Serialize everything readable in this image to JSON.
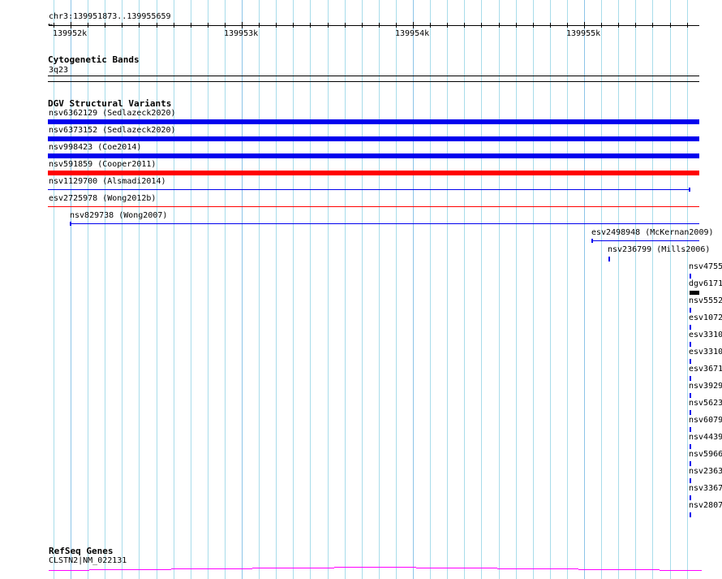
{
  "ruler": {
    "region": "chr3:139951873..139955659",
    "tick_labels": [
      "139952k",
      "139953k",
      "139954k",
      "139955k"
    ]
  },
  "cytoband_track": {
    "title": "Cytogenetic Bands",
    "band": "3q23"
  },
  "dgv_track": {
    "title": "DGV Structural Variants",
    "colors": {
      "gain": "#0000ee",
      "loss": "#ff0000",
      "other": "#000000"
    },
    "features": [
      {
        "label": "nsv6362129 (Sedlazeck2020)",
        "color": "#0000ee",
        "style": "thick"
      },
      {
        "label": "nsv6373152 (Sedlazeck2020)",
        "color": "#0000ee",
        "style": "thick"
      },
      {
        "label": "nsv998423 (Coe2014)",
        "color": "#0000ee",
        "style": "thick"
      },
      {
        "label": "nsv591859 (Cooper2011)",
        "color": "#ff0000",
        "style": "thick"
      },
      {
        "label": "nsv1129700 (Alsmadi2014)",
        "color": "#0000ee",
        "style": "thin"
      },
      {
        "label": "esv2725978 (Wong2012b)",
        "color": "#ff0000",
        "style": "thin"
      },
      {
        "label": "nsv829738 (Wong2007)",
        "color": "#0000ee",
        "style": "thin"
      },
      {
        "label": "esv2498948 (McKernan2009)",
        "color": "#0000ee",
        "style": "thin"
      },
      {
        "label": "nsv236799 (Mills2006)",
        "color": "#0000ee",
        "style": "small"
      },
      {
        "label": "nsv4755",
        "color": "#0000ee",
        "style": "small"
      },
      {
        "label": "dgv6171",
        "color": "#000000",
        "style": "box"
      },
      {
        "label": "nsv5552",
        "color": "#0000ee",
        "style": "small"
      },
      {
        "label": "esv1072",
        "color": "#0000ee",
        "style": "small"
      },
      {
        "label": "esv3310",
        "color": "#0000ee",
        "style": "small"
      },
      {
        "label": "esv3310",
        "color": "#0000ee",
        "style": "small"
      },
      {
        "label": "esv3671",
        "color": "#0000ee",
        "style": "small"
      },
      {
        "label": "nsv3929",
        "color": "#0000ee",
        "style": "small"
      },
      {
        "label": "nsv5623",
        "color": "#0000ee",
        "style": "small"
      },
      {
        "label": "nsv6079",
        "color": "#0000ee",
        "style": "small"
      },
      {
        "label": "nsv4439",
        "color": "#0000ee",
        "style": "small"
      },
      {
        "label": "nsv5966",
        "color": "#0000ee",
        "style": "small"
      },
      {
        "label": "nsv2363",
        "color": "#0000ee",
        "style": "small"
      },
      {
        "label": "nsv3367",
        "color": "#0000ee",
        "style": "small"
      },
      {
        "label": "nsv2807",
        "color": "#0000ee",
        "style": "small"
      }
    ]
  },
  "refseq_track": {
    "title": "RefSeq Genes",
    "gene": "CLSTN2|NM_022131",
    "color": "#ff00ff"
  }
}
